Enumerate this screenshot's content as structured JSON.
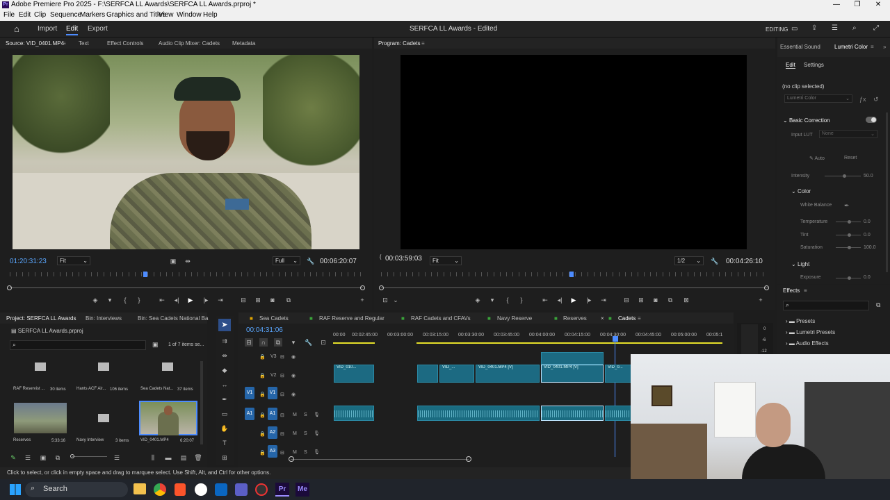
{
  "window": {
    "title": "Adobe Premiere Pro 2025 - F:\\SERFCA LL Awards\\SERFCA LL Awards.prproj *",
    "minimize": "—",
    "restore": "❐",
    "close": "✕"
  },
  "menu": [
    "File",
    "Edit",
    "Clip",
    "Sequence",
    "Markers",
    "Graphics and Titles",
    "View",
    "Window",
    "Help"
  ],
  "appbar": {
    "import": "Import",
    "edit": "Edit",
    "export": "Export",
    "project_title": "SERFCA LL Awards - Edited",
    "workspace": "EDITING"
  },
  "source": {
    "tabs": [
      "Source: VID_0401.MP4",
      "Text",
      "Effect Controls",
      "Audio Clip Mixer: Cadets",
      "Metadata"
    ],
    "timecode": "01:20:31:23",
    "fit": "Fit",
    "quality": "Full",
    "duration": "00:06:20:07"
  },
  "program": {
    "tab": "Program: Cadets",
    "timecode": "00:03:59:03",
    "fit": "Fit",
    "quality": "1/2",
    "duration": "00:04:26:10"
  },
  "project": {
    "tabs": [
      "Project: SERFCA LL Awards",
      "Bin: Interviews",
      "Bin: Sea Cadets National Ba"
    ],
    "file": "SERFCA LL Awards.prproj",
    "count": "1 of 7 items se...",
    "items": [
      {
        "name": "RAF Reservist ...",
        "meta": "30 items"
      },
      {
        "name": "Hants ACF Air...",
        "meta": "106 items"
      },
      {
        "name": "Sea Cadets Nat...",
        "meta": "37 items"
      },
      {
        "name": "Reserves",
        "meta": "5:33:16"
      },
      {
        "name": "Navy Interview",
        "meta": "3 items"
      },
      {
        "name": "VID_0401.MP4",
        "meta": "6:20:07"
      }
    ]
  },
  "timeline": {
    "tabs": [
      "Sea Cadets",
      "RAF Reserve and Regular",
      "RAF Cadets and CFAVs",
      "Navy Reserve",
      "Reserves",
      "Cadets"
    ],
    "timecode": "00:04:31:06",
    "ruler": [
      "00:00",
      "00:02:45:00",
      "00:03:00:00",
      "00:03:15:00",
      "00:03:30:00",
      "00:03:45:00",
      "00:04:00:00",
      "00:04:15:00",
      "00:04:30:00",
      "00:04:45:00",
      "00:05:00:00",
      "00:05:1"
    ],
    "tracks": [
      "V3",
      "V2",
      "V1",
      "A1",
      "A2",
      "A3"
    ],
    "clips": [
      "VID_010...",
      "VID_...",
      "VID_0401.MP4 [V]",
      "VID_0401.MP4 [V]",
      "VID_0..."
    ]
  },
  "essential": {
    "tab1": "Essential Sound",
    "tab2": "Lumetri Color",
    "sub1": "Edit",
    "sub2": "Settings",
    "noclip": "(no clip selected)",
    "effect": "Lumetri Color",
    "basic": "Basic Correction",
    "input_lut": "Input LUT",
    "lut_val": "None",
    "auto": "Auto",
    "reset": "Reset",
    "intensity": "Intensity",
    "intensity_val": "50.0",
    "color": "Color",
    "wb": "White Balance",
    "temperature": "Temperature",
    "temp_val": "0.0",
    "tint": "Tint",
    "tint_val": "0.0",
    "saturation": "Saturation",
    "sat_val": "100.0",
    "light": "Light",
    "exposure": "Exposure",
    "exp_val": "0.0"
  },
  "effects": {
    "tab": "Effects",
    "items": [
      "Presets",
      "Lumetri Presets",
      "Audio Effects"
    ]
  },
  "meter": [
    "0",
    "-6",
    "-12"
  ],
  "status": "Click to select, or click in empty space and drag to marquee select. Use Shift, Alt, and Ctrl for other options.",
  "taskbar": {
    "search": "Search"
  }
}
